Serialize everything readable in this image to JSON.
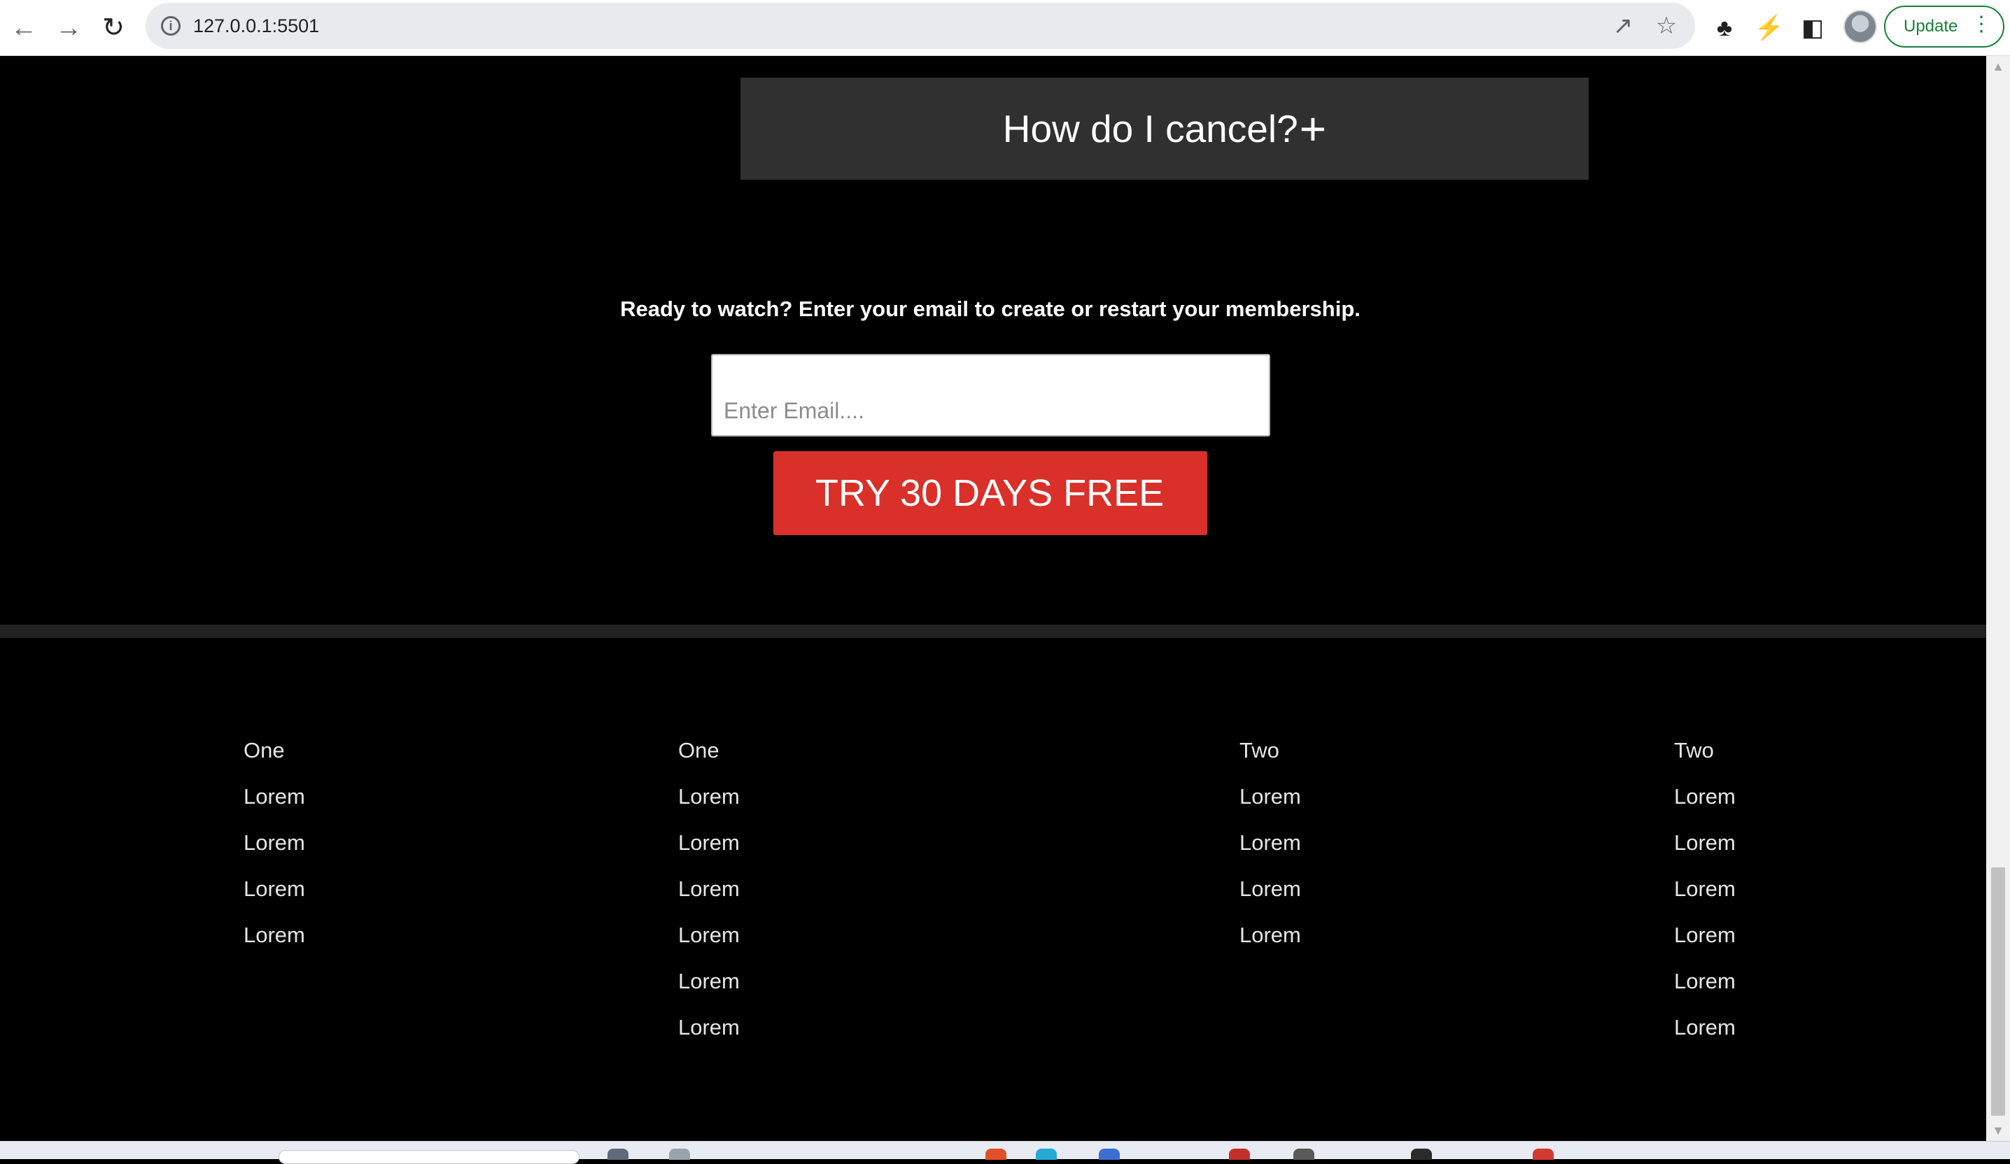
{
  "browser": {
    "url": "127.0.0.1:5501",
    "update_label": "Update",
    "icons": {
      "back": "arrow-left-icon",
      "forward": "arrow-right-icon",
      "reload": "reload-icon",
      "info": "info-icon",
      "share": "share-icon",
      "bookmark": "star-icon",
      "extensions": "puzzle-icon",
      "extension2": "sync-icon",
      "side_panel": "side-panel-icon",
      "menu": "kebab-menu-icon"
    }
  },
  "faq": {
    "question": "How do I cancel?",
    "toggle_glyph": "+"
  },
  "signup": {
    "prompt": "Ready to watch? Enter your email to create or restart your membership.",
    "email_placeholder": "Enter Email....",
    "cta_label": "TRY 30 DAYS FREE",
    "cta_color": "#d93029"
  },
  "footer": {
    "columns": [
      {
        "heading": "One",
        "links": [
          "Lorem",
          "Lorem",
          "Lorem",
          "Lorem"
        ]
      },
      {
        "heading": "One",
        "links": [
          "Lorem",
          "Lorem",
          "Lorem",
          "Lorem",
          "Lorem",
          "Lorem"
        ]
      },
      {
        "heading": "Two",
        "links": [
          "Lorem",
          "Lorem",
          "Lorem",
          "Lorem"
        ]
      },
      {
        "heading": "Two",
        "links": [
          "Lorem",
          "Lorem",
          "Lorem",
          "Lorem",
          "Lorem",
          "Lorem"
        ]
      }
    ]
  },
  "colors": {
    "page_background": "#000000",
    "faq_background": "#303030",
    "divider": "#222222"
  }
}
